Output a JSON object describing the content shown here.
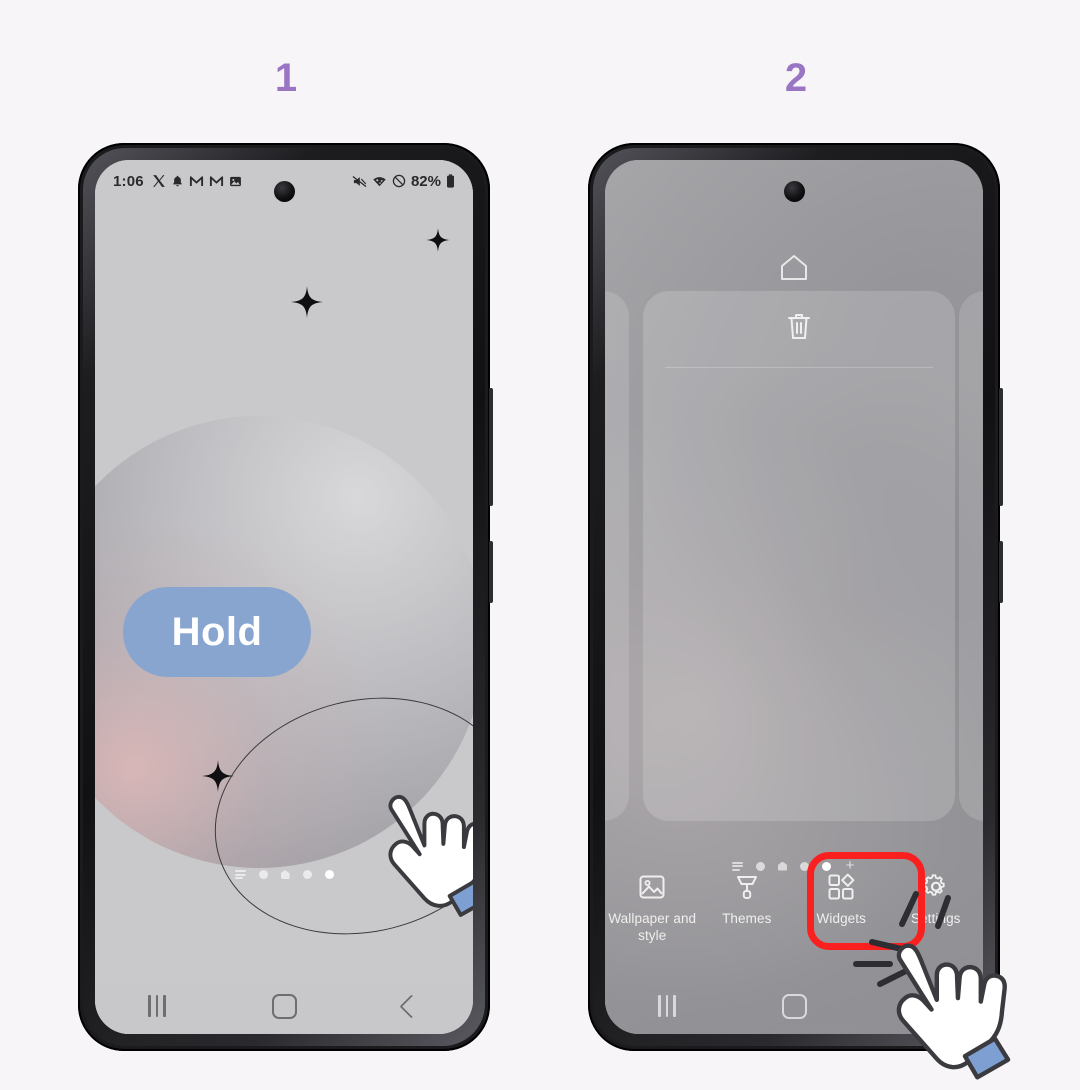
{
  "page": {
    "background_color": "#f7f5f8",
    "accent_step_color": "#9a75c4",
    "highlight_color": "#fb2020"
  },
  "steps": [
    {
      "number": "1"
    },
    {
      "number": "2"
    }
  ],
  "phone1": {
    "status_bar": {
      "clock": "1:06",
      "left_icons": [
        "x-app-icon",
        "notification-bell-icon",
        "gmail-icon",
        "gmail-icon",
        "photo-icon"
      ],
      "right_icons": [
        "mute-icon",
        "wifi-icon",
        "do-not-disturb-icon"
      ],
      "battery_percent": "82%",
      "battery_icon": "battery-icon"
    },
    "gesture": {
      "label": "Hold",
      "pill_color": "#88a5d0",
      "cursor": "hand-cursor"
    },
    "page_indicator": {
      "menu": "page-list-icon",
      "dots": [
        "dot",
        "home-dot",
        "dot",
        "dot-active"
      ],
      "active_index": 3
    },
    "nav_bar": {
      "recents": "recents-icon",
      "home": "home-icon",
      "back": "back-icon"
    }
  },
  "phone2": {
    "edit_mode": {
      "home_icon": "home-outline-icon",
      "trash_icon": "trash-icon"
    },
    "page_indicator": {
      "menu": "page-list-icon",
      "dots": [
        "dot",
        "home-dot",
        "dot",
        "dot-active"
      ],
      "active_index": 3,
      "add_page": "+"
    },
    "toolbar": [
      {
        "label": "Wallpaper and style",
        "icon": "wallpaper-icon",
        "highlighted": false
      },
      {
        "label": "Themes",
        "icon": "themes-brush-icon",
        "highlighted": false
      },
      {
        "label": "Widgets",
        "icon": "widgets-icon",
        "highlighted": true
      },
      {
        "label": "Settings",
        "icon": "gear-icon",
        "highlighted": false
      }
    ],
    "nav_bar": {
      "recents": "recents-icon",
      "home": "home-icon",
      "back": "back-icon"
    },
    "gesture": {
      "cursor": "hand-cursor-tap"
    }
  }
}
